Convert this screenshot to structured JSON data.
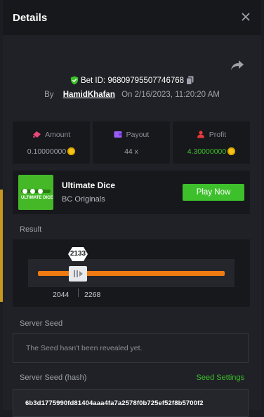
{
  "dialog": {
    "title": "Details"
  },
  "bet": {
    "id_label": "Bet ID:",
    "id_value": "96809795507746768",
    "by_label": "By",
    "user": "HamidKhafan",
    "on_label": "On",
    "datetime": "2/16/2023, 11:20:20 AM"
  },
  "stats": [
    {
      "label": "Amount",
      "value": "0.10000000",
      "icon": "coins-icon",
      "color": "#e8477a"
    },
    {
      "label": "Payout",
      "value": "44 x",
      "icon": "wallet-icon",
      "color": "#9b5cf6"
    },
    {
      "label": "Profit",
      "value": "4.30000000",
      "icon": "profit-icon",
      "color": "#e83a3a"
    }
  ],
  "game": {
    "name": "Ultimate Dice",
    "provider": "BC Originals",
    "thumb_text": "ULTIMATE DICE",
    "play_label": "Play Now"
  },
  "result": {
    "label": "Result",
    "value": "2133",
    "range_low": "2044",
    "range_high": "2268"
  },
  "server_seed": {
    "label": "Server Seed",
    "placeholder": "The Seed hasn't been revealed yet."
  },
  "server_seed_hash": {
    "label": "Server Seed (hash)",
    "settings_label": "Seed Settings",
    "value": "6b3d1775990fd81404aaa4fa7a2578f0b725ef52f8b5700f2"
  },
  "colors": {
    "accent_green": "#3dc02b",
    "track_orange": "#f07a12",
    "coin_gold": "#f5c518"
  }
}
